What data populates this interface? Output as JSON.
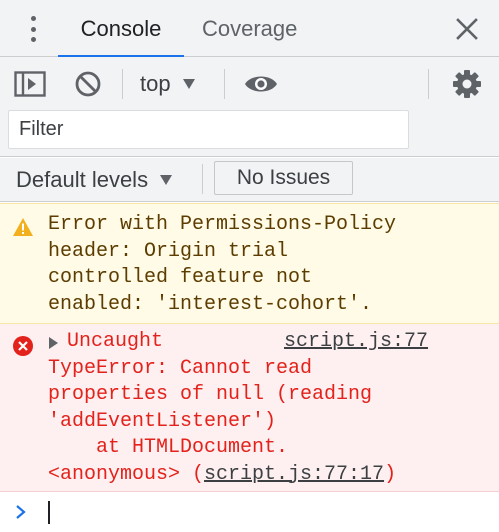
{
  "tabs": [
    {
      "label": "Console",
      "active": true
    },
    {
      "label": "Coverage",
      "active": false
    }
  ],
  "toolbar": {
    "context": "top",
    "filter_placeholder": "Filter",
    "levels_label": "Default levels",
    "issues_label": "No Issues"
  },
  "colors": {
    "accent": "#1a73e8",
    "warning_bg": "#fffbe6",
    "warning_text": "#5c3c00",
    "error_bg": "#fef0f0",
    "error_text": "#e3221c",
    "prompt_chevron": "#1a73e8"
  },
  "icons": {
    "more": "kebab-icon",
    "close": "close-icon",
    "sidebar": "sidebar-toggle-icon",
    "clear": "clear-console-icon",
    "live": "eye-icon",
    "settings": "gear-icon",
    "warning": "warning-icon",
    "error": "error-icon",
    "prompt": "chevron-right-icon"
  },
  "messages": {
    "warning": {
      "lines": [
        "Error with Permissions-Policy",
        "header: Origin trial",
        "controlled feature not",
        "enabled: 'interest-cohort'."
      ]
    },
    "error": {
      "first": "Uncaught",
      "source": "script.js:77",
      "lines": [
        "TypeError: Cannot read",
        "properties of null (reading",
        "'addEventListener')",
        "    at HTMLDocument."
      ],
      "last_prefix": "<anonymous> (",
      "last_link": "script.js:77:17",
      "last_suffix": ")"
    }
  }
}
